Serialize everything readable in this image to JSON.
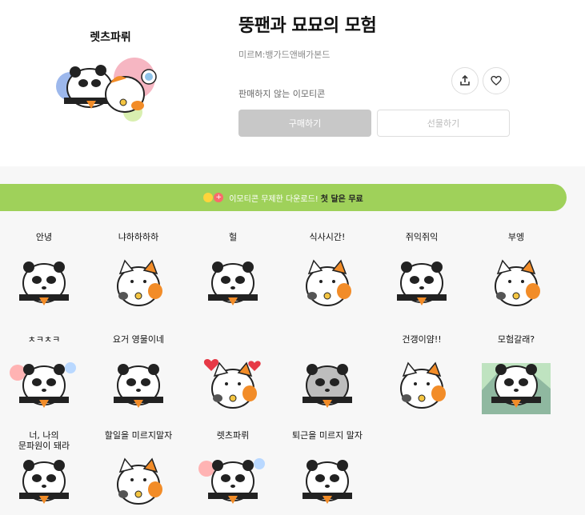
{
  "product": {
    "thumbnail_title": "렛츠파뤼",
    "title": "뚱팬과 묘묘의 모험",
    "author": "미르M:뱅가드앤배가본드",
    "status": "판매하지 않는 이모티콘",
    "buy_label": "구매하기",
    "gift_label": "선물하기"
  },
  "banner": {
    "text": "이모티콘 무제한 다운로드!",
    "highlight": "첫 달은 무료"
  },
  "stickers": [
    {
      "label": "안녕",
      "icon": "panda-waving-icon"
    },
    {
      "label": "냐하하하하",
      "icon": "cat-laughing-icon"
    },
    {
      "label": "헐",
      "icon": "panda-shocked-icon"
    },
    {
      "label": "식사시간!",
      "icon": "cat-eating-icon"
    },
    {
      "label": "쥐익쥐익",
      "icon": "panda-angry-icon"
    },
    {
      "label": "부엥",
      "icon": "cat-crying-icon"
    },
    {
      "label": "ㅊㅋㅊㅋ",
      "icon": "panda-party-icon"
    },
    {
      "label": "요거 영물이네",
      "icon": "panda-smirk-icon"
    },
    {
      "label": "",
      "icon": "cat-hearts-icon"
    },
    {
      "label": "",
      "icon": "panda-sad-icon"
    },
    {
      "label": "건갱이얌!!",
      "icon": "cat-yelling-icon"
    },
    {
      "label": "모험갈래?",
      "icon": "panda-adventure-icon"
    },
    {
      "label": "너, 나의\n문파원이 돼라",
      "icon": "panda-cat-duo-icon"
    },
    {
      "label": "할일을 미르지말자",
      "icon": "cat-working-icon"
    },
    {
      "label": "렛츠파뤼",
      "icon": "panda-cat-party-icon"
    },
    {
      "label": "퇴근을 미르지 말자",
      "icon": "panda-leaving-icon"
    }
  ],
  "colors": {
    "banner": "#9fd15a",
    "buy_button": "#c8c8c8",
    "grid_bg": "#f7f7f7"
  }
}
